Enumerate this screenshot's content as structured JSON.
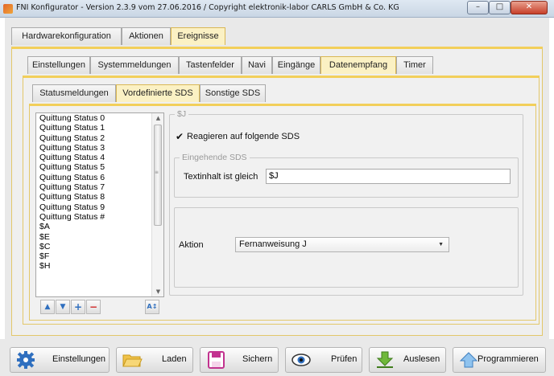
{
  "window": {
    "title": "FNI Konfigurator  -  Version 2.3.9 vom 27.06.2016  /  Copyright elektronik-labor CARLS GmbH & Co. KG",
    "min_glyph": "–",
    "max_glyph": "□",
    "close_glyph": "✕"
  },
  "main_tabs": [
    "Hardwarekonfiguration",
    "Aktionen",
    "Ereignisse"
  ],
  "event_tabs": [
    "Einstellungen",
    "Systemmeldungen",
    "Tastenfelder",
    "Navi",
    "Eingänge",
    "Datenempfang",
    "Timer"
  ],
  "data_tabs": [
    "Statusmeldungen",
    "Vordefinierte SDS",
    "Sonstige SDS"
  ],
  "list": {
    "items": [
      "Quittung Status 0",
      "Quittung Status 1",
      "Quittung Status 2",
      "Quittung Status 3",
      "Quittung Status 4",
      "Quittung Status 5",
      "Quittung Status 6",
      "Quittung Status 7",
      "Quittung Status 8",
      "Quittung Status 9",
      "Quittung Status #",
      "$A",
      "$E",
      "$C",
      "$F",
      "$H"
    ],
    "tools": {
      "up": "▲",
      "down": "▼",
      "add": "+",
      "remove": "−",
      "sort": "A↕"
    }
  },
  "detail": {
    "group_title": "$J",
    "react_check": "✔",
    "react_label": "Reagieren auf folgende SDS",
    "incoming_title": "Eingehende SDS",
    "text_label": "Textinhalt ist gleich",
    "text_value": "$J",
    "action_label": "Aktion",
    "action_value": "Fernanweisung J",
    "dropdown_caret": "▼"
  },
  "buttons": {
    "settings": "Einstellungen",
    "load": "Laden",
    "save": "Sichern",
    "check": "Prüfen",
    "read": "Auslesen",
    "program": "Programmieren"
  },
  "colors": {
    "active_tab": "#fbf1c4",
    "accent": "#f2cf5a"
  }
}
